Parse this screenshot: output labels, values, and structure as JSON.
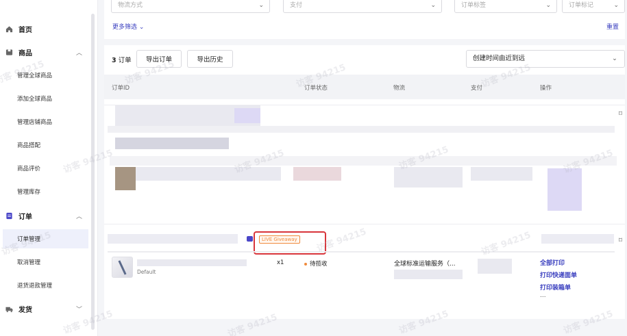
{
  "sidebar": {
    "groups": [
      {
        "label": "首页",
        "icon": "home-icon"
      },
      {
        "label": "商品",
        "icon": "box-icon"
      },
      {
        "label": "订单",
        "icon": "order-icon"
      },
      {
        "label": "发货",
        "icon": "truck-icon"
      }
    ],
    "product_items": [
      "管理全球商品",
      "添加全球商品",
      "管理店铺商品",
      "商品搭配",
      "商品评价",
      "管理库存"
    ],
    "order_items": [
      "订单管理",
      "取消管理",
      "退货退款管理"
    ]
  },
  "filters": {
    "delivery_method": "物流方式",
    "payment": "支付",
    "order_tag": "订单标签",
    "order_mark": "订单标记",
    "more_filters": "更多筛选",
    "reset": "重置"
  },
  "toolbar": {
    "order_count": "3",
    "order_unit": "订单",
    "export_button": "导出订单",
    "export_history_button": "导出历史",
    "sort_value": "创建时间由近到远"
  },
  "table": {
    "columns": [
      "订单ID",
      "订单状态",
      "物流",
      "支付",
      "操作"
    ]
  },
  "order": {
    "badge": "LIVE Giveaway",
    "variant": "Default",
    "quantity": "x1",
    "status": "待揽收",
    "logistics": "全球标准运输服务（...",
    "actions": [
      "全部打印",
      "打印快递面单",
      "打印装箱单",
      "..."
    ]
  },
  "watermark": "访客 94215",
  "colors": {
    "accent": "#3a3fbf",
    "badge": "#f08a3c",
    "highlight": "#d8343a"
  }
}
